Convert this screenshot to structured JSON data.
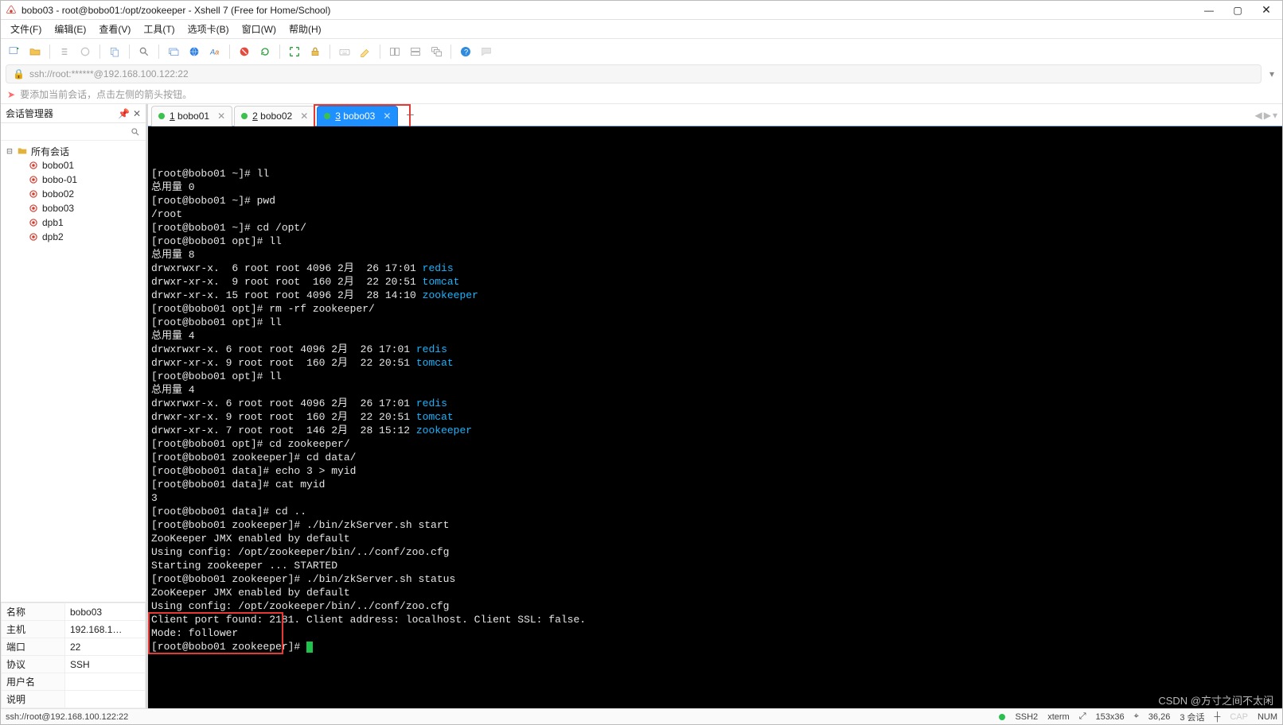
{
  "window": {
    "title": "bobo03 - root@bobo01:/opt/zookeeper - Xshell 7 (Free for Home/School)"
  },
  "menu": {
    "items": [
      "文件(F)",
      "编辑(E)",
      "查看(V)",
      "工具(T)",
      "选项卡(B)",
      "窗口(W)",
      "帮助(H)"
    ]
  },
  "address": {
    "url": "ssh://root:******@192.168.100.122:22"
  },
  "hint": {
    "text": "要添加当前会话，点击左侧的箭头按钮。"
  },
  "sidebar": {
    "title": "会话管理器",
    "root": "所有会话",
    "sessions": [
      "bobo01",
      "bobo-01",
      "bobo02",
      "bobo03",
      "dpb1",
      "dpb2"
    ]
  },
  "props": {
    "rows": [
      {
        "k": "名称",
        "v": "bobo03"
      },
      {
        "k": "主机",
        "v": "192.168.1…"
      },
      {
        "k": "端口",
        "v": "22"
      },
      {
        "k": "协议",
        "v": "SSH"
      },
      {
        "k": "用户名",
        "v": ""
      },
      {
        "k": "说明",
        "v": ""
      }
    ]
  },
  "tabs": {
    "items": [
      {
        "num": "1",
        "label": "bobo01",
        "active": false
      },
      {
        "num": "2",
        "label": "bobo02",
        "active": false
      },
      {
        "num": "3",
        "label": "bobo03",
        "active": true
      }
    ]
  },
  "terminal": {
    "lines": [
      {
        "segs": [
          {
            "t": "[root@bobo01 ~]# ll"
          }
        ]
      },
      {
        "segs": [
          {
            "t": "总用量 0"
          }
        ]
      },
      {
        "segs": [
          {
            "t": "[root@bobo01 ~]# pwd"
          }
        ]
      },
      {
        "segs": [
          {
            "t": "/root"
          }
        ]
      },
      {
        "segs": [
          {
            "t": "[root@bobo01 ~]# cd /opt/"
          }
        ]
      },
      {
        "segs": [
          {
            "t": "[root@bobo01 opt]# ll"
          }
        ]
      },
      {
        "segs": [
          {
            "t": "总用量 8"
          }
        ]
      },
      {
        "segs": [
          {
            "t": "drwxrwxr-x.  6 root root 4096 2月  26 17:01 "
          },
          {
            "t": "redis",
            "c": "hl-blue"
          }
        ]
      },
      {
        "segs": [
          {
            "t": "drwxr-xr-x.  9 root root  160 2月  22 20:51 "
          },
          {
            "t": "tomcat",
            "c": "hl-blue"
          }
        ]
      },
      {
        "segs": [
          {
            "t": "drwxr-xr-x. 15 root root 4096 2月  28 14:10 "
          },
          {
            "t": "zookeeper",
            "c": "hl-blue"
          }
        ]
      },
      {
        "segs": [
          {
            "t": "[root@bobo01 opt]# rm -rf zookeeper/"
          }
        ]
      },
      {
        "segs": [
          {
            "t": "[root@bobo01 opt]# ll"
          }
        ]
      },
      {
        "segs": [
          {
            "t": "总用量 4"
          }
        ]
      },
      {
        "segs": [
          {
            "t": "drwxrwxr-x. 6 root root 4096 2月  26 17:01 "
          },
          {
            "t": "redis",
            "c": "hl-blue"
          }
        ]
      },
      {
        "segs": [
          {
            "t": "drwxr-xr-x. 9 root root  160 2月  22 20:51 "
          },
          {
            "t": "tomcat",
            "c": "hl-blue"
          }
        ]
      },
      {
        "segs": [
          {
            "t": "[root@bobo01 opt]# ll"
          }
        ]
      },
      {
        "segs": [
          {
            "t": "总用量 4"
          }
        ]
      },
      {
        "segs": [
          {
            "t": "drwxrwxr-x. 6 root root 4096 2月  26 17:01 "
          },
          {
            "t": "redis",
            "c": "hl-blue"
          }
        ]
      },
      {
        "segs": [
          {
            "t": "drwxr-xr-x. 9 root root  160 2月  22 20:51 "
          },
          {
            "t": "tomcat",
            "c": "hl-blue"
          }
        ]
      },
      {
        "segs": [
          {
            "t": "drwxr-xr-x. 7 root root  146 2月  28 15:12 "
          },
          {
            "t": "zookeeper",
            "c": "hl-blue"
          }
        ]
      },
      {
        "segs": [
          {
            "t": "[root@bobo01 opt]# cd zookeeper/"
          }
        ]
      },
      {
        "segs": [
          {
            "t": "[root@bobo01 zookeeper]# cd data/"
          }
        ]
      },
      {
        "segs": [
          {
            "t": "[root@bobo01 data]# echo 3 > myid"
          }
        ]
      },
      {
        "segs": [
          {
            "t": "[root@bobo01 data]# cat myid"
          }
        ]
      },
      {
        "segs": [
          {
            "t": "3"
          }
        ]
      },
      {
        "segs": [
          {
            "t": "[root@bobo01 data]# cd .."
          }
        ]
      },
      {
        "segs": [
          {
            "t": "[root@bobo01 zookeeper]# ./bin/zkServer.sh start"
          }
        ]
      },
      {
        "segs": [
          {
            "t": "ZooKeeper JMX enabled by default"
          }
        ]
      },
      {
        "segs": [
          {
            "t": "Using config: /opt/zookeeper/bin/../conf/zoo.cfg"
          }
        ]
      },
      {
        "segs": [
          {
            "t": "Starting zookeeper ... STARTED"
          }
        ]
      },
      {
        "segs": [
          {
            "t": "[root@bobo01 zookeeper]# ./bin/zkServer.sh status"
          }
        ]
      },
      {
        "segs": [
          {
            "t": "ZooKeeper JMX enabled by default"
          }
        ]
      },
      {
        "segs": [
          {
            "t": "Using config: /opt/zookeeper/bin/../conf/zoo.cfg"
          }
        ]
      },
      {
        "segs": [
          {
            "t": "Client port found: 2181. Client address: localhost. Client SSL: false."
          }
        ]
      },
      {
        "segs": [
          {
            "t": "Mode: follower"
          }
        ]
      },
      {
        "segs": [
          {
            "t": "[root@bobo01 zookeeper]# "
          }
        ],
        "cursor": true
      }
    ]
  },
  "statusbar": {
    "left": "ssh://root@192.168.100.122:22",
    "ssh": "SSH2",
    "term": "xterm",
    "size": "153x36",
    "pos": "36,26",
    "sess": "3 会话",
    "caps": "CAP",
    "num": "NUM"
  },
  "watermark": "CSDN @方寸之间不太闲"
}
